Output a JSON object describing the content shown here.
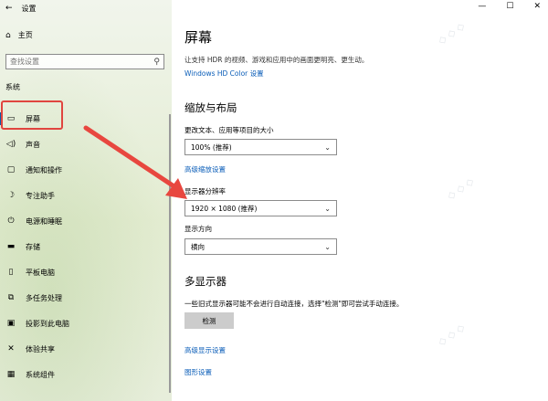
{
  "window": {
    "title": "设置",
    "back": "←",
    "minimize": "—",
    "maximize": "☐",
    "close": "✕"
  },
  "sidebar": {
    "home": "主页",
    "search_placeholder": "查找设置",
    "section": "系统",
    "items": [
      {
        "label": "屏幕",
        "icon": "monitor-icon",
        "glyph": "▭"
      },
      {
        "label": "声音",
        "icon": "speaker-icon",
        "glyph": "◁)"
      },
      {
        "label": "通知和操作",
        "icon": "notification-icon",
        "glyph": "▢"
      },
      {
        "label": "专注助手",
        "icon": "moon-icon",
        "glyph": "☽"
      },
      {
        "label": "电源和睡眠",
        "icon": "power-icon",
        "glyph": "⏻"
      },
      {
        "label": "存储",
        "icon": "storage-icon",
        "glyph": "▬"
      },
      {
        "label": "平板电脑",
        "icon": "tablet-icon",
        "glyph": "▯"
      },
      {
        "label": "多任务处理",
        "icon": "multitask-icon",
        "glyph": "⧉"
      },
      {
        "label": "投影到此电脑",
        "icon": "projection-icon",
        "glyph": "▣"
      },
      {
        "label": "体验共享",
        "icon": "share-icon",
        "glyph": "✕"
      },
      {
        "label": "系统组件",
        "icon": "component-icon",
        "glyph": "▦"
      }
    ]
  },
  "main": {
    "title": "屏幕",
    "hdr_desc": "让支持 HDR 的视频、游戏和应用中的画面更明亮、更生动。",
    "hdr_link": "Windows HD Color 设置",
    "scale_heading": "缩放与布局",
    "scale_label": "更改文本、应用等项目的大小",
    "scale_value": "100% (推荐)",
    "advanced_scale_link": "高级缩放设置",
    "resolution_label": "显示器分辨率",
    "resolution_value": "1920 × 1080 (推荐)",
    "orientation_label": "显示方向",
    "orientation_value": "横向",
    "multi_heading": "多显示器",
    "multi_desc": "一些旧式显示器可能不会进行自动连接，选择\"检测\"即可尝试手动连接。",
    "detect_button": "检测",
    "advanced_display_link": "高级显示设置",
    "graphics_link": "图形设置"
  },
  "colors": {
    "accent": "#0a5db8",
    "highlight": "#e0453f",
    "arrow": "#e8473f"
  }
}
